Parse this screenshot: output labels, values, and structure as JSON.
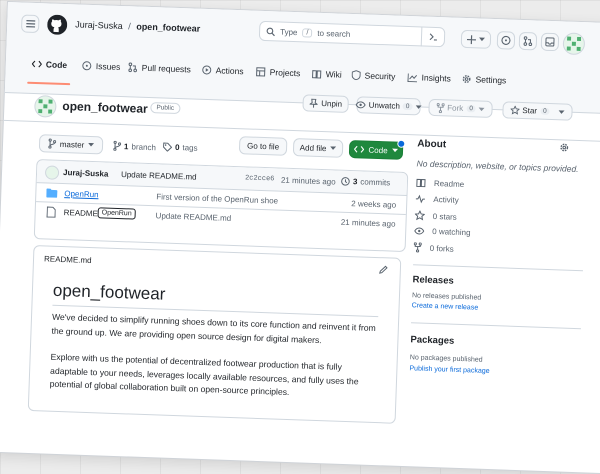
{
  "header": {
    "owner": "Juraj-Suska",
    "separator": "/",
    "repo": "open_footwear",
    "search_prefix": "Type",
    "search_key": "/",
    "search_suffix": "to search"
  },
  "tabs": [
    {
      "label": "Code",
      "icon": "code-icon"
    },
    {
      "label": "Issues",
      "icon": "issue-icon"
    },
    {
      "label": "Pull requests",
      "icon": "pull-request-icon"
    },
    {
      "label": "Actions",
      "icon": "play-icon"
    },
    {
      "label": "Projects",
      "icon": "table-icon"
    },
    {
      "label": "Wiki",
      "icon": "book-icon"
    },
    {
      "label": "Security",
      "icon": "shield-icon"
    },
    {
      "label": "Insights",
      "icon": "graph-icon"
    },
    {
      "label": "Settings",
      "icon": "gear-icon"
    }
  ],
  "repo_bar": {
    "name": "open_footwear",
    "visibility": "Public",
    "unpin": "Unpin",
    "unwatch": "Unwatch",
    "watch_count": "0",
    "fork": "Fork",
    "fork_count": "0",
    "star": "Star",
    "star_count": "0"
  },
  "toolbar": {
    "branch": "master",
    "branch_count": "1",
    "branch_label": "branch",
    "tag_count": "0",
    "tag_label": "tags",
    "goto_file": "Go to file",
    "add_file": "Add file",
    "code": "Code"
  },
  "commit": {
    "author": "Juraj-Suska",
    "message": "Update README.md",
    "hash": "2c2cce6",
    "time": "21 minutes ago",
    "count": "3",
    "count_label": "commits"
  },
  "files": [
    {
      "name": "OpenRun",
      "type": "folder",
      "message": "First version of the OpenRun shoe",
      "time": "2 weeks ago"
    },
    {
      "name": "README.md",
      "type": "file",
      "message": "Update README.md",
      "time": "21 minutes ago"
    }
  ],
  "tooltip": "OpenRun",
  "readme": {
    "filename": "README.md",
    "title": "open_footwear",
    "p1": "We've decided to simplify running shoes down to its core function and reinvent it from the ground up. We are providing open source design for digital makers.",
    "p2": "Explore with us the potential of decentralized footwear production that is fully adaptable to your needs, leverages locally available resources, and fully uses the potential of global collaboration built on open-source principles."
  },
  "about": {
    "title": "About",
    "description": "No description, website, or topics provided.",
    "items": [
      {
        "label": "Readme",
        "icon": "book-icon"
      },
      {
        "label": "Activity",
        "icon": "pulse-icon"
      },
      {
        "label": "0 stars",
        "icon": "star-icon"
      },
      {
        "label": "0 watching",
        "icon": "eye-icon"
      },
      {
        "label": "0 forks",
        "icon": "fork-icon"
      }
    ]
  },
  "releases": {
    "title": "Releases",
    "empty": "No releases published",
    "link": "Create a new release"
  },
  "packages": {
    "title": "Packages",
    "empty": "No packages published",
    "link": "Publish your first package"
  },
  "colors": {
    "accent": "#0969da",
    "primary_button": "#1f883d",
    "tab_underline": "#fd8c73"
  }
}
